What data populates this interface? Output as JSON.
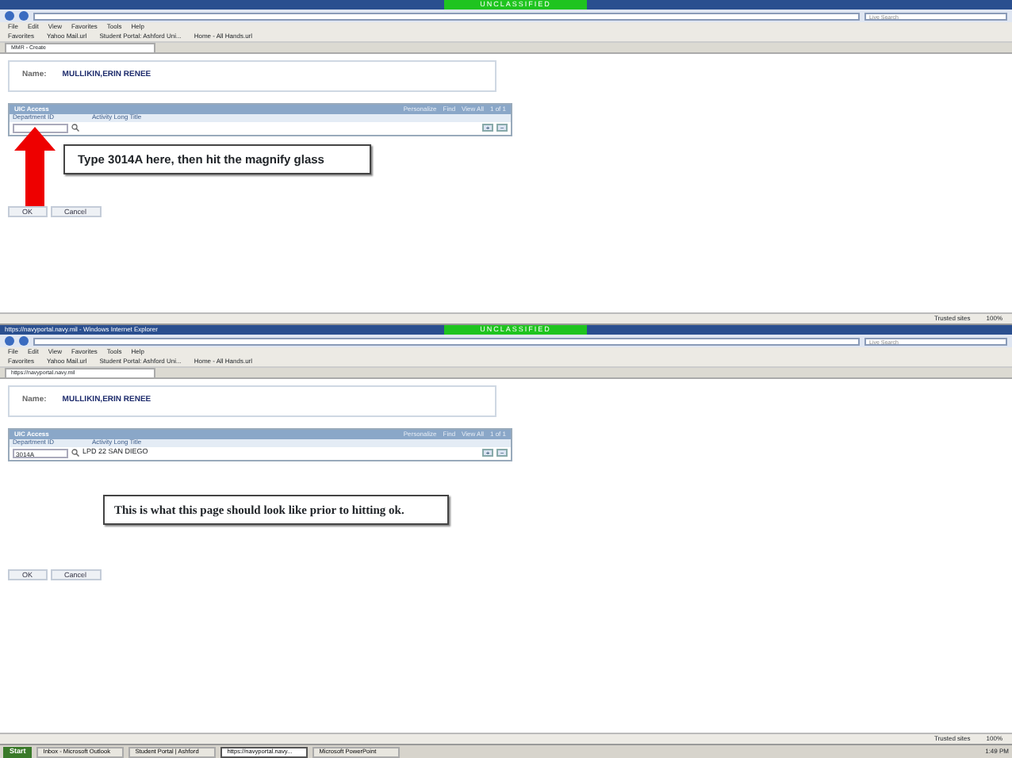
{
  "windows": [
    {
      "banner": "UNCLASSIFIED",
      "menu": [
        "File",
        "Edit",
        "View",
        "Favorites",
        "Tools",
        "Help"
      ],
      "favorites": [
        "Favorites",
        "Yahoo Mail.url",
        "Student Portal: Ashford Uni...",
        "Home - All Hands.url"
      ],
      "tab": "MMR - Create",
      "search_placeholder": "Live Search",
      "name_label": "Name:",
      "name_value": "MULLIKIN,ERIN RENEE",
      "grid": {
        "title": "UIC Access",
        "tools": [
          "Personalize",
          "Find",
          "View All"
        ],
        "pager": "1 of 1",
        "columns": [
          "Department ID",
          "Activity Long Title"
        ],
        "row": {
          "buttons": [
            "+",
            "−"
          ]
        }
      },
      "callout": {
        "kind": "arrow",
        "text": "Type 3014A here, then hit the magnify glass"
      },
      "buttons": [
        "OK",
        "Cancel"
      ],
      "status": [
        "Trusted sites",
        "100%"
      ]
    },
    {
      "title": "https://navyportal.navy.mil - Windows Internet Explorer",
      "banner": "UNCLASSIFIED",
      "menu": [
        "File",
        "Edit",
        "View",
        "Favorites",
        "Tools",
        "Help"
      ],
      "favorites": [
        "Favorites",
        "Yahoo Mail.url",
        "Student Portal: Ashford Uni...",
        "Home - All Hands.url"
      ],
      "tab": "https://navyportal.navy.mil",
      "search_placeholder": "Live Search",
      "name_label": "Name:",
      "name_value": "MULLIKIN,ERIN RENEE",
      "grid": {
        "title": "UIC Access",
        "tools": [
          "Personalize",
          "Find",
          "View All"
        ],
        "pager": "1 of 1",
        "columns": [
          "Department ID",
          "Activity Long Title"
        ],
        "row": {
          "department_id": "3014A",
          "activity": "LPD 22 SAN DIEGO",
          "buttons": [
            "+",
            "−"
          ]
        }
      },
      "callout": {
        "kind": "note",
        "text": "This is what this page should look like prior to hitting ok."
      },
      "buttons": [
        "OK",
        "Cancel"
      ],
      "status": [
        "Trusted sites",
        "100%"
      ]
    }
  ],
  "taskbar": {
    "start": "Start",
    "items": [
      {
        "label": "Inbox - Microsoft Outlook",
        "selected": false
      },
      {
        "label": "Student Portal | Ashford",
        "selected": false
      },
      {
        "label": "https://navyportal.navy...",
        "selected": true
      },
      {
        "label": "Microsoft PowerPoint",
        "selected": false
      }
    ],
    "clock": "1:49 PM"
  }
}
